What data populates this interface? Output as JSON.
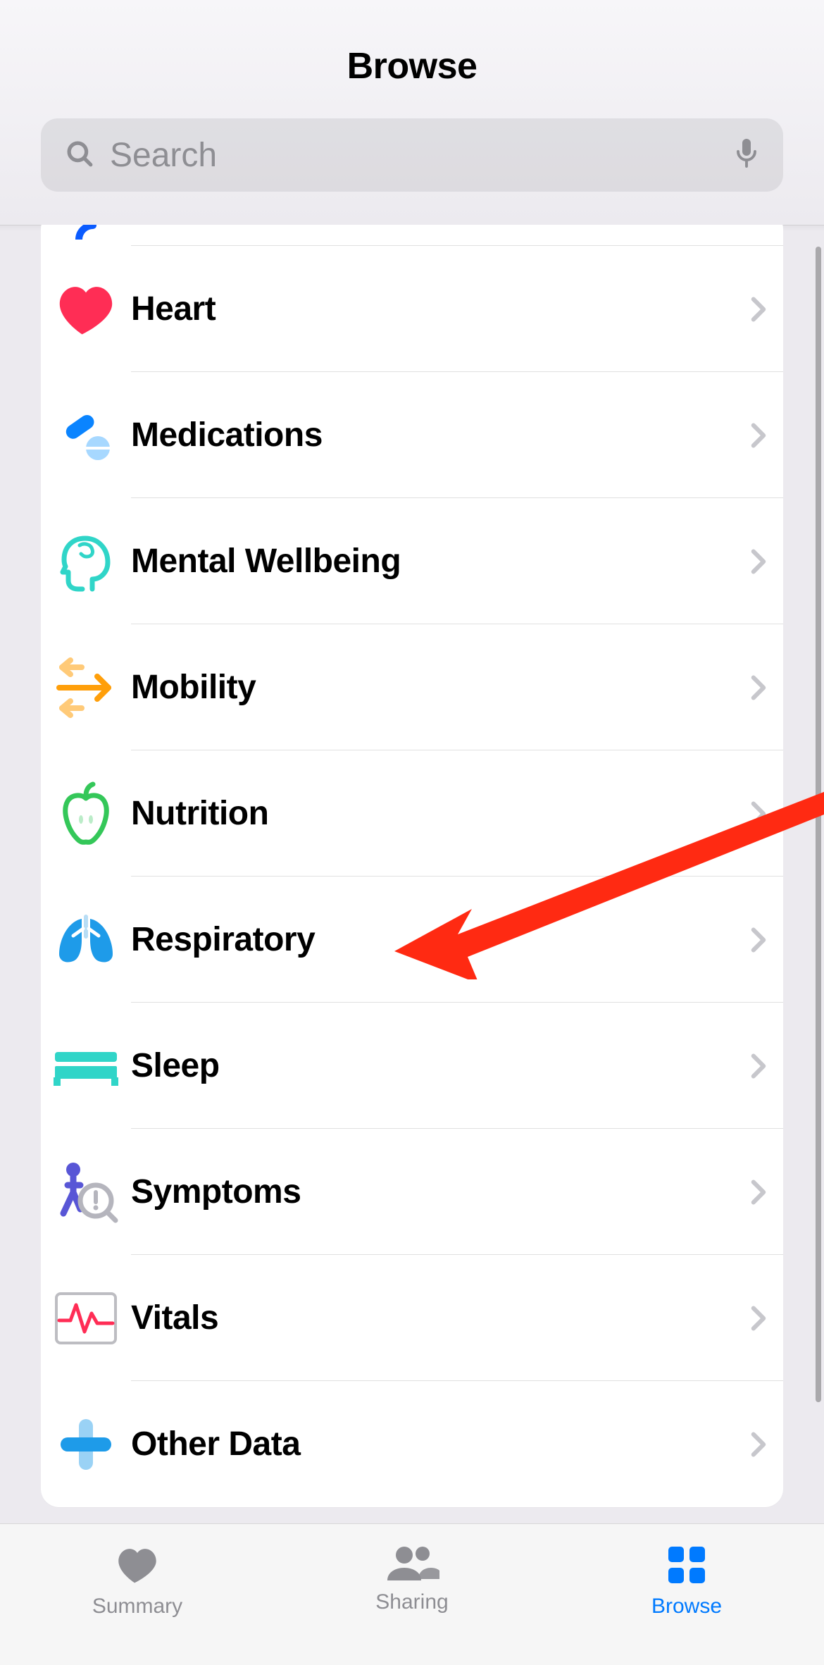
{
  "header": {
    "title": "Browse"
  },
  "search": {
    "placeholder": "Search"
  },
  "categories": [
    {
      "id": "heart",
      "label": "Heart",
      "icon": "heart-icon",
      "color": "#ff2d55"
    },
    {
      "id": "medications",
      "label": "Medications",
      "icon": "pills-icon",
      "color": "#0a84ff"
    },
    {
      "id": "mental-wellbeing",
      "label": "Mental Wellbeing",
      "icon": "brain-icon",
      "color": "#30d5c8"
    },
    {
      "id": "mobility",
      "label": "Mobility",
      "icon": "arrows-icon",
      "color": "#ff9f0a"
    },
    {
      "id": "nutrition",
      "label": "Nutrition",
      "icon": "apple-icon",
      "color": "#34c759"
    },
    {
      "id": "respiratory",
      "label": "Respiratory",
      "icon": "lungs-icon",
      "color": "#1e9be9"
    },
    {
      "id": "sleep",
      "label": "Sleep",
      "icon": "bed-icon",
      "color": "#30d5c8"
    },
    {
      "id": "symptoms",
      "label": "Symptoms",
      "icon": "symptom-icon",
      "color": "#5856d6"
    },
    {
      "id": "vitals",
      "label": "Vitals",
      "icon": "waveform-icon",
      "color": "#ff2d55"
    },
    {
      "id": "other-data",
      "label": "Other Data",
      "icon": "plus-icon",
      "color": "#1e9be9"
    }
  ],
  "tabs": [
    {
      "id": "summary",
      "label": "Summary",
      "active": false
    },
    {
      "id": "sharing",
      "label": "Sharing",
      "active": false
    },
    {
      "id": "browse",
      "label": "Browse",
      "active": true
    }
  ],
  "annotation": {
    "target": "respiratory",
    "color": "#ff2a12"
  }
}
